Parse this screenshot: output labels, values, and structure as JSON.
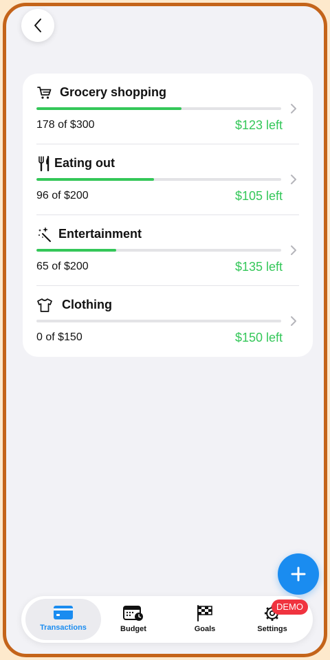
{
  "colors": {
    "accent": "#1a8cf0",
    "progress": "#34c759",
    "remaining": "#34c759",
    "badge": "#f0333f",
    "frame": "#c4641a"
  },
  "budget_items": [
    {
      "title": "Grocery shopping",
      "icon": "cart-icon",
      "spent_text": "178 of $300",
      "left_text": "$123 left",
      "progress": 0.593
    },
    {
      "title": "Eating out",
      "icon": "fork-knife-icon",
      "spent_text": "96 of $200",
      "left_text": "$105 left",
      "progress": 0.48
    },
    {
      "title": "Entertainment",
      "icon": "magic-wand-icon",
      "spent_text": "65 of $200",
      "left_text": "$135 left",
      "progress": 0.325
    },
    {
      "title": "Clothing",
      "icon": "tshirt-icon",
      "spent_text": "0 of $150",
      "left_text": "$150 left",
      "progress": 0.0
    }
  ],
  "tabs": [
    {
      "label": "Transactions",
      "icon": "card-icon",
      "active": true
    },
    {
      "label": "Budget",
      "icon": "calendar-clock-icon",
      "active": false
    },
    {
      "label": "Goals",
      "icon": "checkered-flag-icon",
      "active": false
    },
    {
      "label": "Settings",
      "icon": "gear-icon",
      "active": false
    }
  ],
  "settings_badge": "DEMO",
  "back_icon": "chevron-left-icon",
  "add_icon": "plus-icon"
}
